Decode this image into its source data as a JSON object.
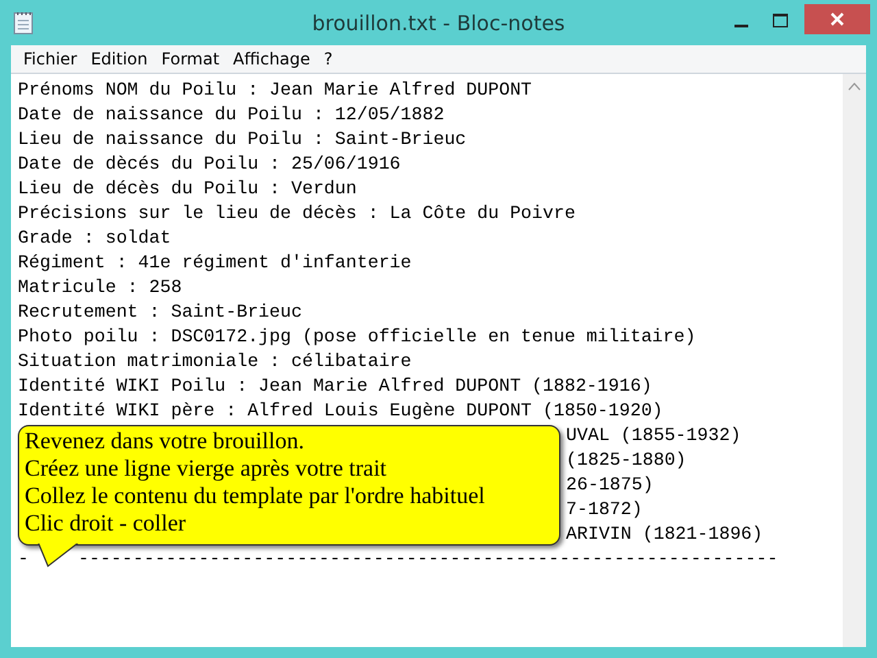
{
  "window": {
    "title": "brouillon.txt - Bloc-notes"
  },
  "menu": [
    {
      "label": "Fichier"
    },
    {
      "label": "Edition"
    },
    {
      "label": "Format"
    },
    {
      "label": "Affichage"
    },
    {
      "label": "?"
    }
  ],
  "editor": {
    "lines": [
      {
        "kind": "full",
        "text": "Prénoms NOM du Poilu : Jean Marie Alfred DUPONT"
      },
      {
        "kind": "full",
        "text": "Date de naissance du Poilu : 12/05/1882"
      },
      {
        "kind": "full",
        "text": "Lieu de naissance du Poilu : Saint-Brieuc"
      },
      {
        "kind": "full",
        "text": "Date de dècés du Poilu : 25/06/1916"
      },
      {
        "kind": "full",
        "text": "Lieu de décès du Poilu : Verdun"
      },
      {
        "kind": "full",
        "text": "Précisions sur le lieu de décès : La Côte du Poivre"
      },
      {
        "kind": "full",
        "text": "Grade : soldat"
      },
      {
        "kind": "full",
        "text": "Régiment : 41e régiment d'infanterie"
      },
      {
        "kind": "full",
        "text": "Matricule : 258"
      },
      {
        "kind": "full",
        "text": "Recrutement : Saint-Brieuc"
      },
      {
        "kind": "full",
        "text": "Photo poilu : DSC0172.jpg (pose officielle en tenue militaire)"
      },
      {
        "kind": "full",
        "text": "Situation matrimoniale : célibataire"
      },
      {
        "kind": "full",
        "text": "Identité WIKI Poilu : Jean Marie Alfred DUPONT (1882-1916)"
      },
      {
        "kind": "full",
        "text": "Identité WIKI père : Alfred Louis Eugène DUPONT (1850-1920)"
      },
      {
        "kind": "partial",
        "text": "UVAL (1855-1932)"
      },
      {
        "kind": "partial",
        "text": "(1825-1880)"
      },
      {
        "kind": "partial",
        "text": "26-1875)"
      },
      {
        "kind": "partial",
        "text": "7-1872)"
      },
      {
        "kind": "partial",
        "text": "ARIVIN (1821-1896)"
      },
      {
        "kind": "split",
        "parts": [
          "-",
          "----------------------------------------------------------------"
        ]
      }
    ]
  },
  "callout": {
    "lines": [
      "Revenez dans votre brouillon.",
      "Créez une ligne vierge après votre trait",
      "Collez le contenu du template par l'ordre habituel",
      "Clic droit - coller"
    ]
  }
}
